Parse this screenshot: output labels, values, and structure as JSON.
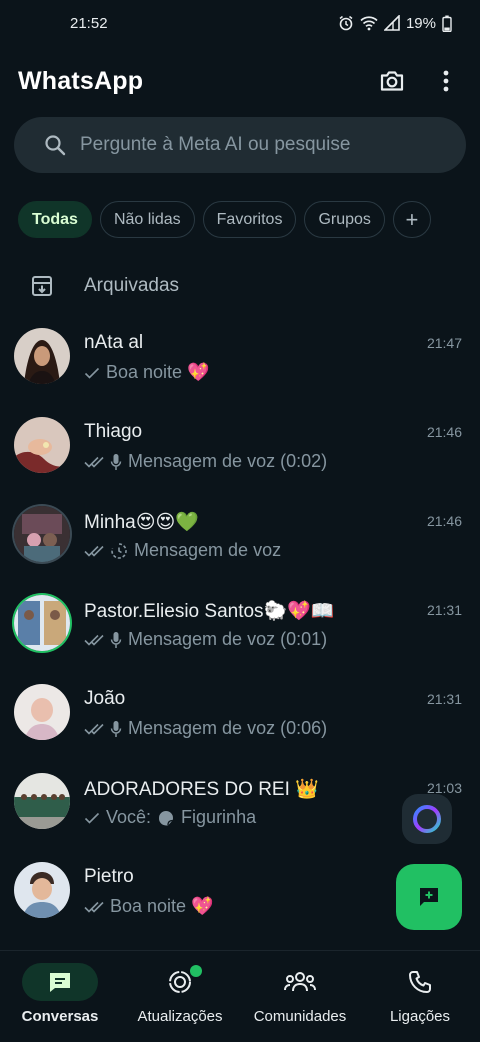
{
  "status_bar": {
    "time": "21:52",
    "battery": "19%",
    "icons": [
      "alarm-icon",
      "wifi-icon",
      "signal-icon",
      "battery-icon"
    ]
  },
  "header": {
    "title": "WhatsApp",
    "actions": [
      "camera-icon",
      "more-vertical-icon"
    ]
  },
  "search": {
    "placeholder": "Pergunte à Meta AI ou pesquise"
  },
  "filters": {
    "chips": [
      "Todas",
      "Não lidas",
      "Favoritos",
      "Grupos"
    ],
    "active": "Todas",
    "add_label": "+"
  },
  "archived": {
    "label": "Arquivadas"
  },
  "chats": [
    {
      "name": "nAta al",
      "time": "21:47",
      "status": "sent",
      "preview_prefix": "",
      "preview_icon": "",
      "preview": "Boa noite 💖"
    },
    {
      "name": "Thiago",
      "time": "21:46",
      "status": "delivered",
      "preview_prefix": "",
      "preview_icon": "mic-icon",
      "preview": "Mensagem de voz (0:02)"
    },
    {
      "name": "Minha😍😍💚",
      "time": "21:46",
      "status": "delivered",
      "preview_prefix": "",
      "preview_icon": "timer-icon",
      "preview": "Mensagem de voz"
    },
    {
      "name": "Pastor.Eliesio Santos🐑💖📖",
      "time": "21:31",
      "status": "delivered",
      "preview_prefix": "",
      "preview_icon": "mic-icon",
      "preview": "Mensagem de voz (0:01)"
    },
    {
      "name": "João",
      "time": "21:31",
      "status": "delivered",
      "preview_prefix": "",
      "preview_icon": "mic-icon",
      "preview": "Mensagem de voz (0:06)"
    },
    {
      "name": "ADORADORES DO REI 👑",
      "time": "21:03",
      "status": "sent",
      "preview_prefix": "Você:",
      "preview_icon": "sticker-icon",
      "preview": "Figurinha"
    },
    {
      "name": "Pietro",
      "time": "",
      "status": "delivered",
      "preview_prefix": "",
      "preview_icon": "",
      "preview": "Boa noite 💖"
    }
  ],
  "bottom_nav": {
    "items": [
      {
        "label": "Conversas",
        "icon": "chats-icon",
        "active": true
      },
      {
        "label": "Atualizações",
        "icon": "updates-icon",
        "active": false
      },
      {
        "label": "Comunidades",
        "icon": "communities-icon",
        "active": false
      },
      {
        "label": "Ligações",
        "icon": "phone-icon",
        "active": false
      }
    ]
  },
  "colors": {
    "background": "#0b141a",
    "accent": "#21c063",
    "active_chip_bg": "#103529",
    "search_bg": "#202c33",
    "secondary_text": "#8696a0"
  }
}
